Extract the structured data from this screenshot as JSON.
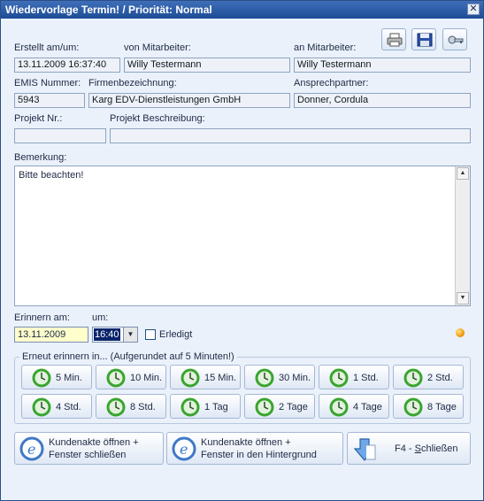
{
  "window": {
    "title": "Wiedervorlage Termin! / Priorität: Normal",
    "close_glyph": "✕"
  },
  "toolbar": {
    "print_icon": "printer-icon",
    "save_icon": "floppy-disk-icon",
    "key_icon": "key-icon"
  },
  "fields": {
    "created_label": "Erstellt am/um:",
    "created_value": "13.11.2009 16:37:40",
    "from_label": "von Mitarbeiter:",
    "from_value": "Willy Testermann",
    "to_label": "an Mitarbeiter:",
    "to_value": "Willy Testermann",
    "emis_label": "EMIS Nummer:",
    "emis_value": "5943",
    "company_label": "Firmenbezeichnung:",
    "company_value": "Karg EDV-Dienstleistungen GmbH",
    "contact_label": "Ansprechpartner:",
    "contact_value": "Donner, Cordula",
    "project_no_label": "Projekt Nr.:",
    "project_no_value": "",
    "project_desc_label": "Projekt Beschreibung:",
    "project_desc_value": ""
  },
  "remark": {
    "label": "Bemerkung:",
    "text": "Bitte beachten!"
  },
  "reminder": {
    "date_label": "Erinnern am:",
    "date_value": "13.11.2009",
    "time_label": "um:",
    "time_value": "16:40",
    "done_label": "Erledigt",
    "done_checked": false,
    "status_led_color": "#f39b0c"
  },
  "remind_again": {
    "title": "Erneut erinnern in...  (Aufgerundet auf 5 Minuten!)",
    "buttons": [
      "5 Min.",
      "10 Min.",
      "15 Min.",
      "30 Min.",
      "1 Std.",
      "2 Std.",
      "4 Std.",
      "8 Std.",
      "1 Tag",
      "2 Tage",
      "4 Tage",
      "8 Tage"
    ]
  },
  "actions": {
    "open_close_l1": "Kundenakte öffnen +",
    "open_close_l2": "Fenster schließen",
    "open_bg_l1": "Kundenakte öffnen +",
    "open_bg_l2": "Fenster in den Hintergrund",
    "close_pre": "F4 - ",
    "close_underlined": "S",
    "close_post": "chließen"
  },
  "colors": {
    "accent": "#1d4c96",
    "background": "#eaf1fb",
    "date_highlight": "#ffffcc",
    "clock_green": "#3aa52f"
  }
}
